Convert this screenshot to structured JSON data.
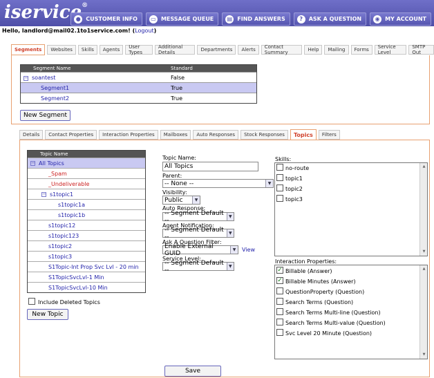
{
  "header": {
    "logo": "iservice",
    "logo_mark": "®",
    "nav": [
      {
        "label": "CUSTOMER INFO",
        "icon": "person-icon"
      },
      {
        "label": "MESSAGE QUEUE",
        "icon": "inbox-icon"
      },
      {
        "label": "FIND ANSWERS",
        "icon": "book-icon"
      },
      {
        "label": "ASK A QUESTION",
        "icon": "question-icon"
      },
      {
        "label": "MY ACCOUNT",
        "icon": "account-icon"
      }
    ]
  },
  "user": {
    "hello": "Hello, landlord@mail02.1to1service.com!",
    "logout_open": "(",
    "logout": "Logout",
    "logout_close": ")"
  },
  "main_tabs": [
    "Segments",
    "Websites",
    "Skills",
    "Agents",
    "User Types",
    "Additional Details",
    "Departments",
    "Alerts",
    "Contact Summary",
    "Help",
    "Mailing",
    "Forms",
    "Service Level",
    "SMTP Out"
  ],
  "segments": {
    "headers": [
      "Segment Name",
      "Standard"
    ],
    "rows": [
      {
        "name": "soantest",
        "standard": "False",
        "expand": "−"
      },
      {
        "name": "Segment1",
        "standard": "True"
      },
      {
        "name": "Segment2",
        "standard": "True"
      }
    ],
    "new_button": "New Segment"
  },
  "sub_tabs": [
    "Details",
    "Contact Properties",
    "Interaction Properties",
    "Mailboxes",
    "Auto Responses",
    "Stock Responses",
    "Topics",
    "Filters"
  ],
  "topics": {
    "header": "Topic Name",
    "rows": [
      {
        "label": "All Topics",
        "expand": "−"
      },
      {
        "label": "_Spam"
      },
      {
        "label": "_Undeliverable"
      },
      {
        "label": "s1topic1",
        "expand": "−"
      },
      {
        "label": "s1topic1a"
      },
      {
        "label": "s1topic1b"
      },
      {
        "label": "s1topic12"
      },
      {
        "label": "s1topic123"
      },
      {
        "label": "s1topic2"
      },
      {
        "label": "s1topic3"
      },
      {
        "label": "S1Topic-Int Prop Svc Lvl - 20 min"
      },
      {
        "label": "S1TopicSvcLvl-1 Min"
      },
      {
        "label": "S1TopicSvcLvl-10 Min"
      }
    ],
    "include_deleted": "Include Deleted Topics",
    "new_button": "New Topic"
  },
  "form": {
    "topic_name_label": "Topic Name:",
    "topic_name_value": "All Topics",
    "parent_label": "Parent:",
    "parent_value": "-- None --",
    "visibility_label": "Visibility:",
    "visibility_value": "Public",
    "auto_response_label": "Auto Response:",
    "auto_response_value": "-- Segment Default --",
    "agent_notification_label": "Agent Notification:",
    "agent_notification_value": "-- Segment Default --",
    "ask_filter_label": "Ask A Question Filter:",
    "ask_filter_value": "Enable External GUID",
    "view_link": "View",
    "service_level_label": "Service Level:",
    "service_level_value": "-- Segment Default --",
    "save_button": "Save"
  },
  "skills": {
    "label": "Skills:",
    "items": [
      {
        "label": "no-route",
        "checked": false
      },
      {
        "label": "topic1",
        "checked": false
      },
      {
        "label": "topic2",
        "checked": false
      },
      {
        "label": "topic3",
        "checked": false
      }
    ]
  },
  "interaction_properties": {
    "label": "Interaction Properties:",
    "items": [
      {
        "label": "Billable (Answer)",
        "checked": true
      },
      {
        "label": "Billable Minutes (Answer)",
        "checked": true
      },
      {
        "label": "QuestionProperty (Question)",
        "checked": false
      },
      {
        "label": "Search Terms (Question)",
        "checked": false
      },
      {
        "label": "Search Terms Multi-line (Question)",
        "checked": false
      },
      {
        "label": "Search Terms Multi-value (Question)",
        "checked": false
      },
      {
        "label": "Svc Level 20 Minute (Question)",
        "checked": false
      }
    ]
  },
  "check_mark": "✓"
}
